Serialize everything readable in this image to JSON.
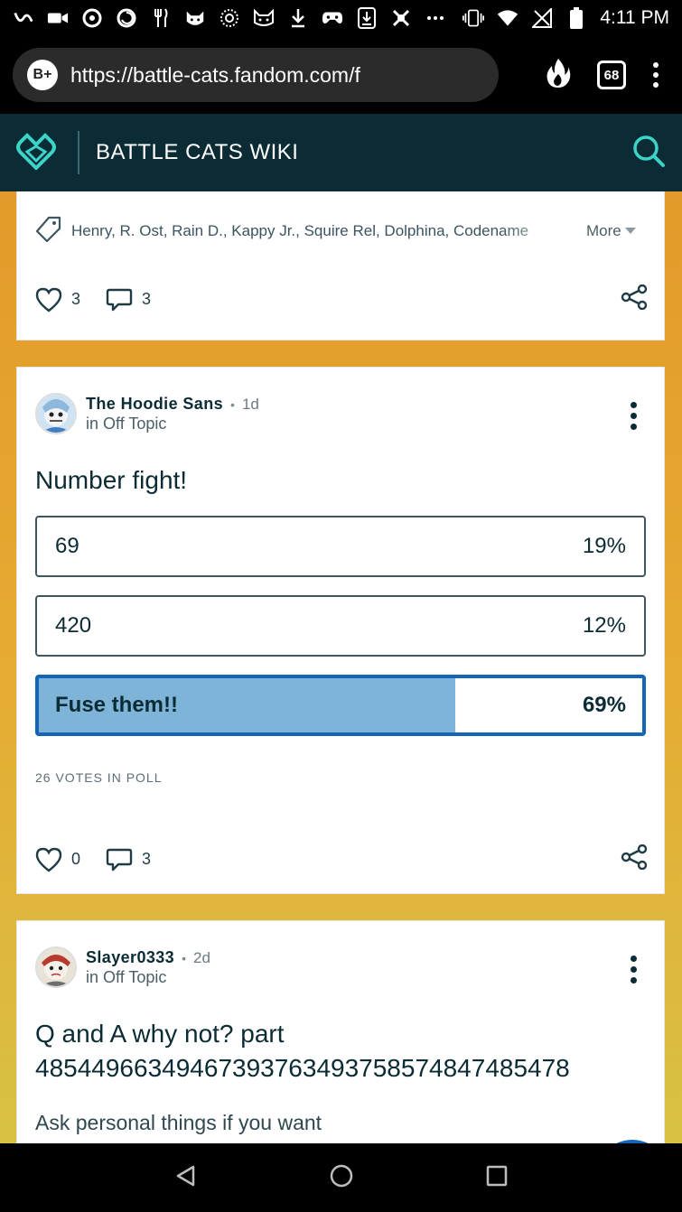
{
  "status_bar": {
    "time": "4:11 PM",
    "notification_icons": [
      "unknown-app-icon",
      "video-camera-icon",
      "app-o-icon",
      "app-spiral-icon",
      "fork-knife-icon",
      "cat-face-icon",
      "dotted-circle-icon",
      "cat-face-icon",
      "download-icon",
      "gamepad-icon",
      "download-icon",
      "hazard-icon",
      "more-icon"
    ],
    "system_icons": [
      "vibrate-icon",
      "wifi-icon",
      "no-signal-icon",
      "battery-icon"
    ]
  },
  "browser": {
    "url": "https://battle-cats.fandom.com/f",
    "site_badge": "B+",
    "tab_count": "68"
  },
  "wiki_header": {
    "title": "BATTLE CATS WIKI"
  },
  "posts": [
    {
      "tags": "Henry, R. Ost, Rain D., Kappy Jr., Squire Rel, Dolphina, Codename",
      "more_label": "More",
      "likes": "3",
      "comments": "3"
    },
    {
      "author": "The Hoodie Sans",
      "time": "1d",
      "category": "in Off Topic",
      "title": "Number fight!",
      "poll": {
        "options": [
          {
            "label": "69",
            "percent_label": "19%",
            "percent": 19
          },
          {
            "label": "420",
            "percent_label": "12%",
            "percent": 12
          },
          {
            "label": "Fuse them!!",
            "percent_label": "69%",
            "percent": 69,
            "selected": true
          }
        ],
        "votes_label": "26 VOTES IN POLL"
      },
      "likes": "0",
      "comments": "3"
    },
    {
      "author": "Slayer0333",
      "time": "2d",
      "category": "in Off Topic",
      "title_line1": "Q and A why not? part",
      "title_line2": "48544966349467393763493758574847485478",
      "body": "Ask personal things if you want"
    }
  ],
  "colors": {
    "wiki_header_bg": "#0b2b35",
    "accent": "#1565b6",
    "poll_fill": "#7fb4d9",
    "background_top": "#e39a2a",
    "background_bottom": "#d8c143"
  }
}
